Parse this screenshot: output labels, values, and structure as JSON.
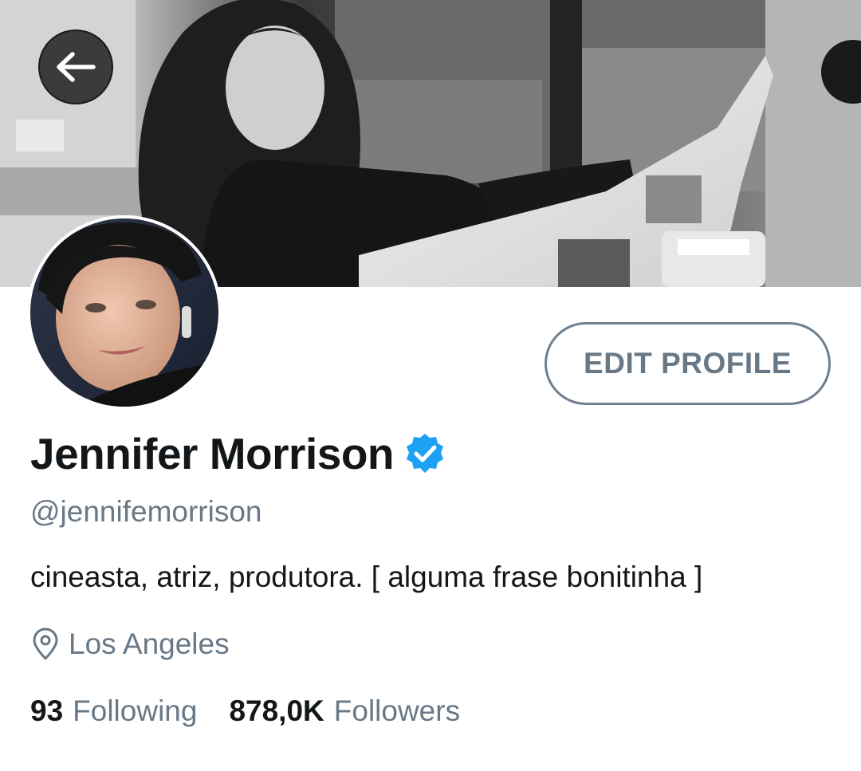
{
  "navigation": {
    "back_icon": "arrow-left-icon"
  },
  "profile": {
    "display_name": "Jennifer Morrison",
    "verified_icon": "verified-badge-icon",
    "handle": "@jennifemorrison",
    "bio": "cineasta, atriz, produtora. [ alguma frase bonitinha ]",
    "location_icon": "location-pin-icon",
    "location": "Los Angeles",
    "edit_button_label": "EDIT PROFILE"
  },
  "stats": {
    "following_count": "93",
    "following_label": "Following",
    "followers_count": "878,0K",
    "followers_label": "Followers"
  },
  "colors": {
    "accent_blue": "#1da1f2",
    "secondary_text": "#687886",
    "primary_text": "#14171a"
  }
}
